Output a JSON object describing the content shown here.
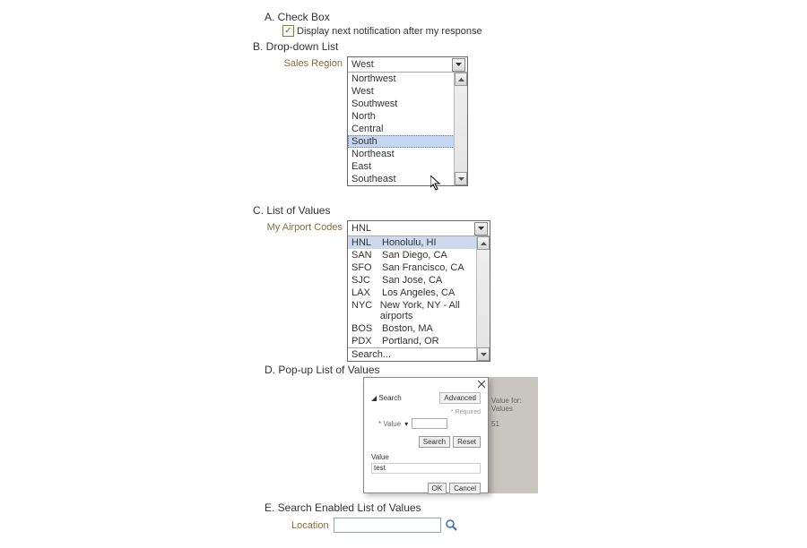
{
  "sections": {
    "a": "A. Check Box",
    "b": "B. Drop-down List",
    "c": "C. List of Values",
    "d": "D. Pop-up List of Values",
    "e": "E. Search Enabled List of Values"
  },
  "checkbox": {
    "label": "Display next notification after my response",
    "checked": true
  },
  "dropdown": {
    "label": "Sales Region",
    "value": "West",
    "options": [
      "Northwest",
      "West",
      "Southwest",
      "North",
      "Central",
      "South",
      "Northeast",
      "East",
      "Southeast"
    ],
    "highlighted": "South"
  },
  "lov": {
    "label": "My Airport Codes",
    "value": "HNL",
    "rows": [
      {
        "code": "HNL",
        "desc": "Honolulu, HI"
      },
      {
        "code": "SAN",
        "desc": "San Diego, CA"
      },
      {
        "code": "SFO",
        "desc": "San Francisco, CA"
      },
      {
        "code": "SJC",
        "desc": "San Jose, CA"
      },
      {
        "code": "LAX",
        "desc": "Los Angeles, CA"
      },
      {
        "code": "NYC",
        "desc": "New York, NY - All airports"
      },
      {
        "code": "BOS",
        "desc": "Boston, MA"
      },
      {
        "code": "PDX",
        "desc": "Portland, OR"
      }
    ],
    "search_label": "Search..."
  },
  "popup": {
    "search_label": "Search",
    "advanced": "Advanced",
    "required": "* Required",
    "field_label": "* Value",
    "field_op": "▾",
    "search_btn": "Search",
    "reset_btn": "Reset",
    "value_heading": "Value",
    "value": "test",
    "ok": "OK",
    "cancel": "Cancel"
  },
  "side_panel": {
    "line1": "Value for:",
    "line2": "Values",
    "line3": "51"
  },
  "search_lov": {
    "label": "Location"
  },
  "icons": {
    "check": "✓"
  }
}
